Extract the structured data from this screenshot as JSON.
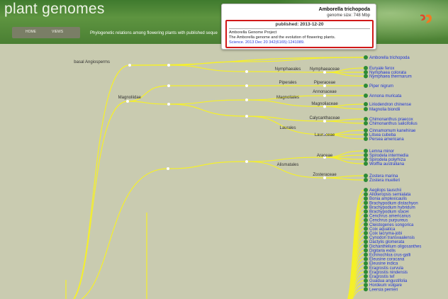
{
  "header": {
    "site_title": "plant genomes",
    "menu": [
      "HOME",
      "VIEWS"
    ],
    "tagline": "Phylogenetic relations among flowering plants with published seque"
  },
  "popup": {
    "species": "Amborella trichopoda",
    "genome_size": "genome size: 748 Mbp",
    "published": "published: 2013-12-20",
    "project": "Amborella Genome Project",
    "article_title": "The Amborella genome and the evolution of flowering plants.",
    "citation": "Science. 2013 Dec 20 342(6165):1241089."
  },
  "colors": {
    "branch": "#f5f02a",
    "tip_node": "#2e8b36",
    "tip_label": "#2035d8",
    "popup_border": "#d01818"
  },
  "tree": {
    "clades": [
      "basal Angiosperms",
      "Magnoliidae",
      "Nymphaeales",
      "Nymphaeaceae",
      "Piperales",
      "Piperaceae",
      "Annonaceae",
      "Magnoliales",
      "Magnoliaceae",
      "Calycanthaceae",
      "Laurales",
      "Lauraceae",
      "Araceae",
      "Alismatales",
      "Zosteraceae"
    ],
    "tips": [
      "Amborella trichopoda",
      "Euryale ferox",
      "Nymphaea colorata",
      "Nymphaea thermarum",
      "Piper nigrum",
      "Annona muricata",
      "Liriodendron chinense",
      "Magnolia biondii",
      "Chimonanthus praecox",
      "Chimonanthus salicifolius",
      "Cinnamomum kanehirae",
      "Litsea cubeba",
      "Persea americana",
      "Lemna minor",
      "Spirodela intermedia",
      "Spirodela polyrhiza",
      "Wolffia australiana",
      "Zostera marina",
      "Zostera muelleri",
      "Aegilops tauschii",
      "Alloteropsis semialata",
      "Bonia amplexicaulis",
      "Brachypodium distachyon",
      "Brachypodium hybridum",
      "Brachypodium stacei",
      "Cenchrus americanus",
      "Cenchrus purpureus",
      "Cleistogenes songorica",
      "Coix aquatica",
      "Coix lacryma-jobi",
      "Cynodon transvaalensis",
      "Dactylis glomerata",
      "Dichanthelium oligosanthes",
      "Digitaria exilis",
      "Echinochloa crus-galli",
      "Eleusine coracana",
      "Eleusine indica",
      "Eragrostis curvula",
      "Eragrostis nindensis",
      "Eragrostis tef",
      "Guadua angustifolia",
      "Hordeum vulgare",
      "Leersia perrieri"
    ]
  }
}
